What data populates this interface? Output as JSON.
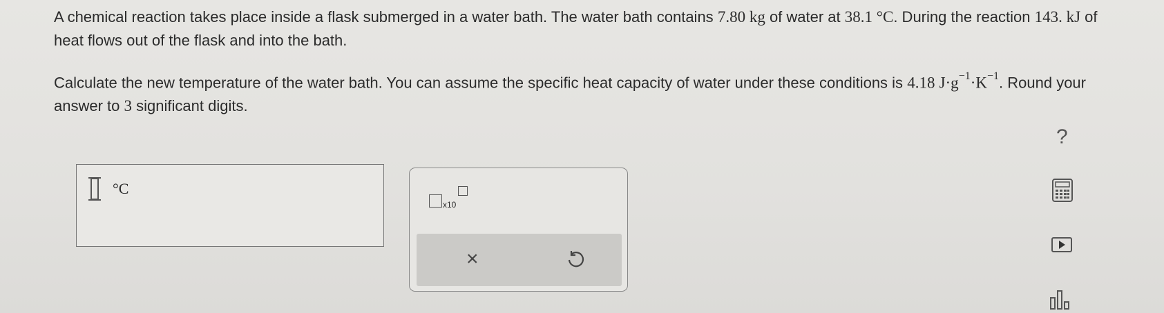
{
  "question": {
    "p1_text": "A chemical reaction takes place inside a flask submerged in a water bath. The water bath contains",
    "p1_mass": "7.80 kg",
    "p1_text2": "of water at",
    "p1_temp": "38.1 °C",
    "p1_text3": ". During the reaction",
    "p1_heat": "143. kJ",
    "p1_text4": "of heat flows out of the flask and into the bath.",
    "p2_text": "Calculate the new temperature of the water bath. You can assume the specific heat capacity of water under these conditions is",
    "p2_value": "4.18",
    "p2_unit_j": "J·g",
    "p2_exp1": "−1",
    "p2_unit_k": "·K",
    "p2_exp2": "−1",
    "p2_text2": ". Round your answer to",
    "p2_digits": "3",
    "p2_text3": "significant digits."
  },
  "answer": {
    "value": "",
    "unit": "°C"
  },
  "tools": {
    "sci_notation_label": "x10",
    "clear_icon": "×"
  },
  "sidebar": {
    "help_label": "?"
  },
  "icons": [
    "calculator-icon",
    "play-icon",
    "bar-chart-icon",
    "undo-icon",
    "clear-icon",
    "help-icon"
  ]
}
